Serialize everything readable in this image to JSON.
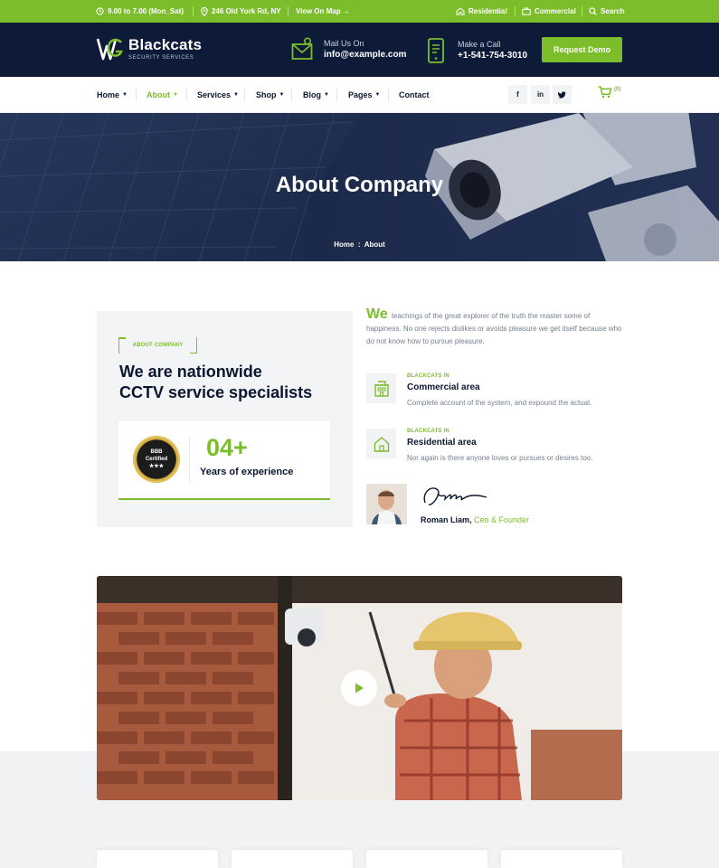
{
  "colors": {
    "accent": "#7cbd2c",
    "navy": "#0d1a38",
    "text": "#0b1730",
    "muted": "#75808f"
  },
  "topbar": {
    "hours": "9.00 to 7.00 (Mon_Sat)",
    "address": "246 Old York Rd, NY",
    "map_link": "View On Map →",
    "residential": "Residential",
    "commercial": "Commercial",
    "search": "Search"
  },
  "header": {
    "logo_name": "Blackcats",
    "logo_sub": "SECURITY SERVICES",
    "mail_label": "Mail Us On",
    "mail_value": "info@example.com",
    "call_label": "Make a Call",
    "call_value": "+1-541-754-3010",
    "demo_button": "Request Demo"
  },
  "nav": {
    "items": [
      {
        "label": "Home"
      },
      {
        "label": "About"
      },
      {
        "label": "Services"
      },
      {
        "label": "Shop"
      },
      {
        "label": "Blog"
      },
      {
        "label": "Pages"
      },
      {
        "label": "Contact"
      }
    ],
    "social": [
      "facebook-icon",
      "linkedin-icon",
      "twitter-icon"
    ],
    "cart_count": "(0)"
  },
  "hero": {
    "title": "About Company",
    "breadcrumb_home": "Home",
    "breadcrumb_sep": ":",
    "breadcrumb_current": "About"
  },
  "about": {
    "tag": "ABOUT COMPANY",
    "title_line1": "We are nationwide",
    "title_line2": "CCTV service specialists",
    "badge_line1": "BBB",
    "badge_line2": "Certified",
    "badge_stars": "★★★",
    "years": "04+",
    "years_label": "Years of experience"
  },
  "intro": {
    "lead": "We",
    "text": "teachings of the great explorer of the truth the master some of happiness. No one rejects dislikes or avoids pleasure we get itself because who do not know how to pursue pleasure."
  },
  "features": [
    {
      "tag": "BLACKCATS IN",
      "title": "Commercial area",
      "desc": "Complete account of the system, and expound the actual.",
      "icon": "building-icon"
    },
    {
      "tag": "BLACKCATS IN",
      "title": "Residential area",
      "desc": "Nor again is there anyone loves or pursues or desires too.",
      "icon": "house-icon"
    }
  ],
  "author": {
    "name": "Roman Liam,",
    "role": "Ceo & Founder"
  }
}
